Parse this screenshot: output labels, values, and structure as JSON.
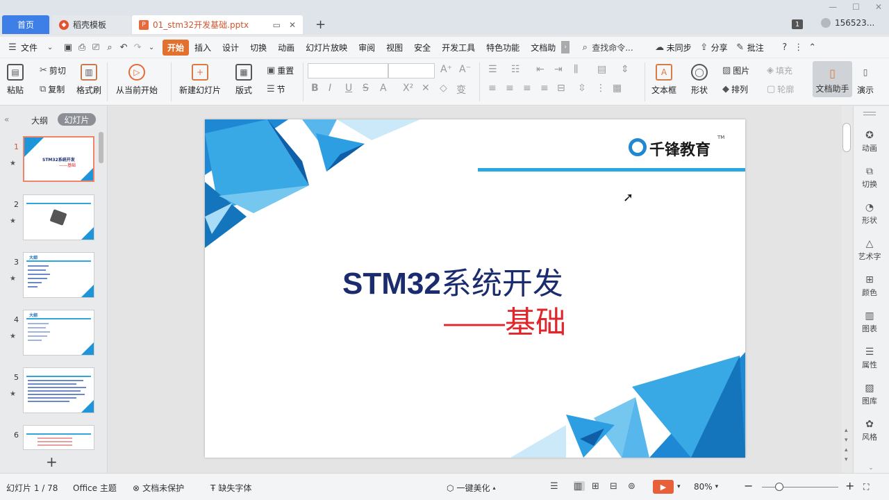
{
  "tabs": {
    "home": "首页",
    "template": "稻壳模板",
    "document": "01_stm32开发基础.pptx"
  },
  "window": {
    "badge": "1",
    "account": "156523..."
  },
  "menu": {
    "file": "文件",
    "items": [
      "开始",
      "插入",
      "设计",
      "切换",
      "动画",
      "幻灯片放映",
      "审阅",
      "视图",
      "安全",
      "开发工具",
      "特色功能",
      "文档助"
    ],
    "search": "查找命令...",
    "sync": "未同步",
    "share": "分享",
    "comment": "批注"
  },
  "ribbon": {
    "paste": "粘贴",
    "cut": "剪切",
    "copy": "复制",
    "format_painter": "格式刷",
    "from_current": "从当前开始",
    "new_slide": "新建幻灯片",
    "layout": "版式",
    "reset": "重置",
    "section": "节",
    "textbox": "文本框",
    "shape": "形状",
    "picture": "图片",
    "fill": "填充",
    "arrange": "排列",
    "outline": "轮廓",
    "doc_assistant": "文档助手",
    "present": "演示"
  },
  "left_panel": {
    "outline_tab": "大纲",
    "slides_tab": "幻灯片",
    "thumbnails": [
      {
        "num": "1",
        "title": "STM32系统开发",
        "subtitle": "——基础"
      },
      {
        "num": "2",
        "title": ""
      },
      {
        "num": "3",
        "title": "大纲"
      },
      {
        "num": "4",
        "title": "大纲"
      },
      {
        "num": "5",
        "title": ""
      },
      {
        "num": "6",
        "title": ""
      }
    ]
  },
  "slide": {
    "title_en": "STM32",
    "title_cn": "系统开发",
    "subtitle": "——基础",
    "logo": "千锋教育",
    "logo_tm": "TM"
  },
  "right_bar": [
    "动画",
    "切换",
    "形状",
    "艺术字",
    "颜色",
    "图表",
    "属性",
    "图库",
    "风格"
  ],
  "status": {
    "slide_pos": "幻灯片 1 / 78",
    "theme": "Office 主题",
    "protect": "文档未保护",
    "missing_font": "缺失字体",
    "beautify": "一键美化",
    "zoom": "80%"
  }
}
